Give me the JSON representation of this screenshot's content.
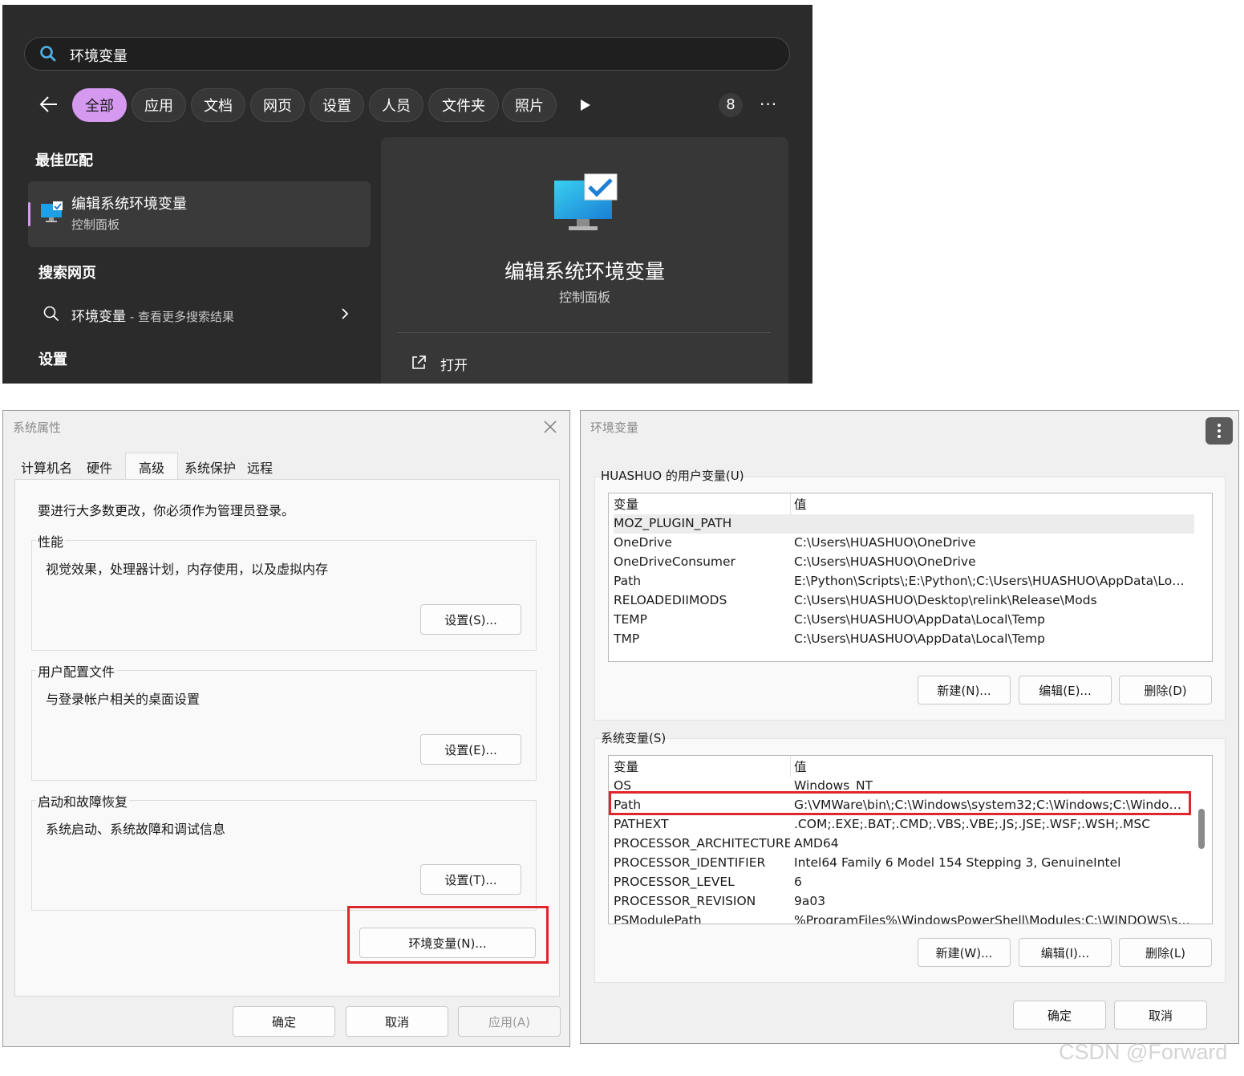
{
  "search": {
    "query": "环境变量",
    "chips": [
      "全部",
      "应用",
      "文档",
      "网页",
      "设置",
      "人员",
      "文件夹",
      "照片"
    ],
    "active_chip": "全部",
    "count": "8",
    "more": "···",
    "best_match_title": "最佳匹配",
    "best_match": {
      "title": "编辑系统环境变量",
      "subtitle": "控制面板"
    },
    "web_section_title": "搜索网页",
    "web_item": {
      "query": "环境变量",
      "suffix": " - 查看更多搜索结果"
    },
    "settings_section_title": "设置",
    "detail": {
      "title": "编辑系统环境变量",
      "subtitle": "控制面板",
      "open_label": "打开"
    },
    "colors": {
      "background": "#2b2b2b",
      "accent": "#d59af0"
    }
  },
  "sys_props": {
    "title": "系统属性",
    "tabs": [
      "计算机名",
      "硬件",
      "高级",
      "系统保护",
      "远程"
    ],
    "active_tab": "高级",
    "admin_note": "要进行大多数更改，你必须作为管理员登录。",
    "performance": {
      "label": "性能",
      "desc": "视觉效果，处理器计划，内存使用，以及虚拟内存",
      "button": "设置(S)..."
    },
    "user_profiles": {
      "label": "用户配置文件",
      "desc": "与登录帐户相关的桌面设置",
      "button": "设置(E)..."
    },
    "startup": {
      "label": "启动和故障恢复",
      "desc": "系统启动、系统故障和调试信息",
      "button": "设置(T)..."
    },
    "env_button": "环境变量(N)...",
    "ok": "确定",
    "cancel": "取消",
    "apply": "应用(A)"
  },
  "env_vars": {
    "title": "环境变量",
    "user_section": "HUASHUO 的用户变量(U)",
    "system_section": "系统变量(S)",
    "col_var": "变量",
    "col_val": "值",
    "user_rows": [
      {
        "name": "MOZ_PLUGIN_PATH",
        "value": ""
      },
      {
        "name": "OneDrive",
        "value": "C:\\Users\\HUASHUO\\OneDrive"
      },
      {
        "name": "OneDriveConsumer",
        "value": "C:\\Users\\HUASHUO\\OneDrive"
      },
      {
        "name": "Path",
        "value": "E:\\Python\\Scripts\\;E:\\Python\\;C:\\Users\\HUASHUO\\AppData\\Local\\..."
      },
      {
        "name": "RELOADEDIIMODS",
        "value": "C:\\Users\\HUASHUO\\Desktop\\relink\\Release\\Mods"
      },
      {
        "name": "TEMP",
        "value": "C:\\Users\\HUASHUO\\AppData\\Local\\Temp"
      },
      {
        "name": "TMP",
        "value": "C:\\Users\\HUASHUO\\AppData\\Local\\Temp"
      }
    ],
    "system_rows": [
      {
        "name": "OS",
        "value": "Windows_NT"
      },
      {
        "name": "Path",
        "value": "G:\\VMWare\\bin\\;C:\\Windows\\system32;C:\\Windows;C:\\Windows\\S..."
      },
      {
        "name": "PATHEXT",
        "value": ".COM;.EXE;.BAT;.CMD;.VBS;.VBE;.JS;.JSE;.WSF;.WSH;.MSC"
      },
      {
        "name": "PROCESSOR_ARCHITECTURE",
        "value": "AMD64"
      },
      {
        "name": "PROCESSOR_IDENTIFIER",
        "value": "Intel64 Family 6 Model 154 Stepping 3, GenuineIntel"
      },
      {
        "name": "PROCESSOR_LEVEL",
        "value": "6"
      },
      {
        "name": "PROCESSOR_REVISION",
        "value": "9a03"
      },
      {
        "name": "PSModulePath",
        "value": "%ProgramFiles%\\WindowsPowerShell\\Modules;C:\\WINDOWS\\syst..."
      }
    ],
    "user_buttons": {
      "new": "新建(N)...",
      "edit": "编辑(E)...",
      "delete": "删除(D)"
    },
    "system_buttons": {
      "new": "新建(W)...",
      "edit": "编辑(I)...",
      "delete": "删除(L)"
    },
    "ok": "确定",
    "cancel": "取消",
    "highlight_color": "#e0252b"
  },
  "watermark": "CSDN @Forward"
}
